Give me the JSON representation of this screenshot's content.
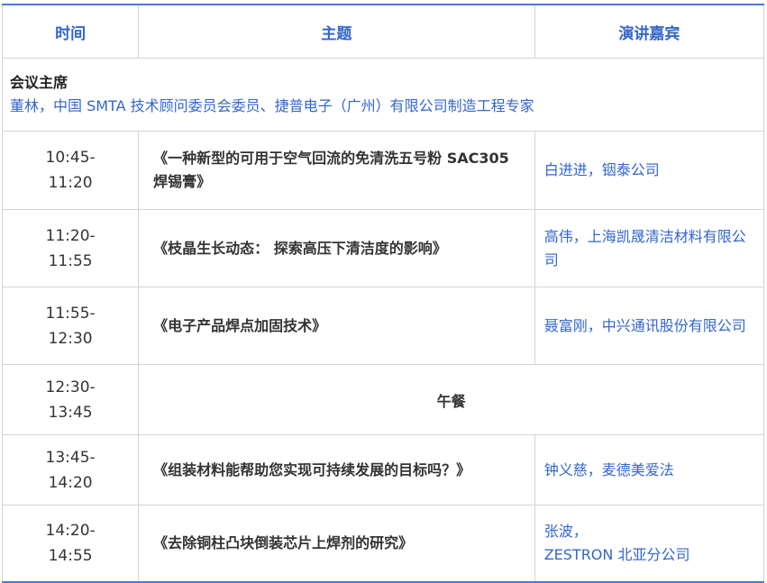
{
  "header": {
    "time": "时间",
    "topic": "主题",
    "speaker": "演讲嘉宾"
  },
  "chair": {
    "title": "会议主席",
    "text": "董林，中国 SMTA 技术顾问委员会委员、捷普电子（广州）有限公司制造工程专家"
  },
  "rows": [
    {
      "time_start": "10:45-",
      "time_end": "11:20",
      "topic": "《一种新型的可用于空气回流的免清洗五号粉 SAC305 焊锡膏》",
      "speaker": "白进进，铟泰公司"
    },
    {
      "time_start": "11:20-",
      "time_end": "11:55",
      "topic": "《枝晶生长动态： 探索高压下清洁度的影响》",
      "speaker": "高伟，上海凯晟清洁材料有限公司"
    },
    {
      "time_start": "11:55-",
      "time_end": "12:30",
      "topic": "《电子产品焊点加固技术》",
      "speaker": "聂富刚，中兴通讯股份有限公司"
    },
    {
      "time_start": "12:30-",
      "time_end": "13:45",
      "topic": "午餐",
      "speaker": ""
    },
    {
      "time_start": "13:45-",
      "time_end": "14:20",
      "topic": "《组装材料能帮助您实现可持续发展的目标吗？》",
      "speaker": "钟义慈，麦德美爱法"
    },
    {
      "time_start": "14:20-",
      "time_end": "14:55",
      "topic": "《去除铜柱凸块倒装芯片上焊剂的研究》",
      "speaker_line1": "张波，",
      "speaker_line2": "ZESTRON 北亚分公司"
    }
  ],
  "colors": {
    "accent": "#3366cc",
    "border_top": "#4a7bd0",
    "grid": "#d4d4d4"
  }
}
